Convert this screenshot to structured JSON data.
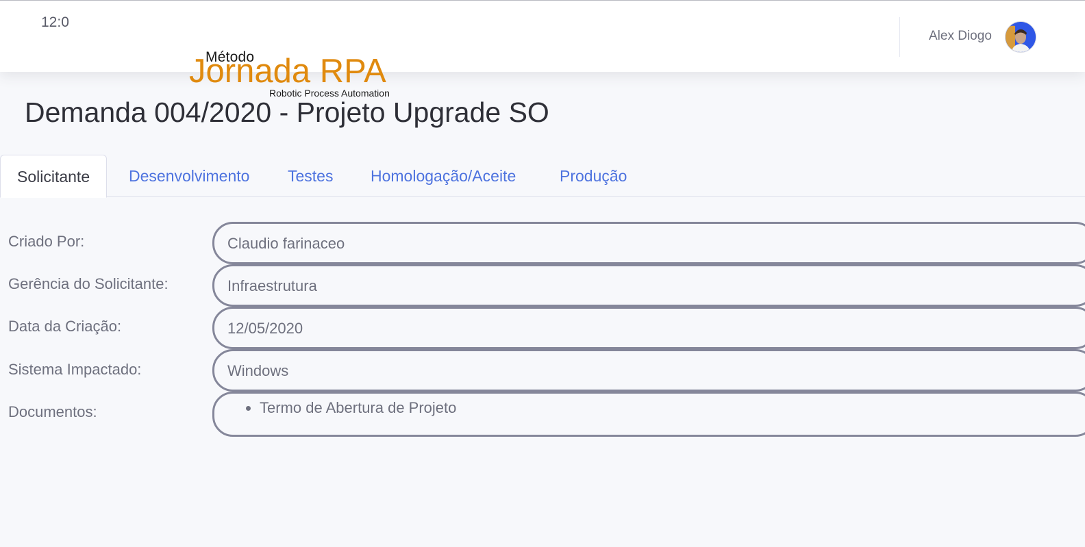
{
  "header": {
    "clock": "12:0",
    "user_name": "Alex Diogo"
  },
  "logo": {
    "line1": "Método",
    "line2": "Jornada RPA",
    "line3": "Robotic Process Automation"
  },
  "page_title": "Demanda 004/2020 - Projeto Upgrade SO",
  "tabs": [
    {
      "label": "Solicitante",
      "active": true
    },
    {
      "label": "Desenvolvimento",
      "active": false
    },
    {
      "label": "Testes",
      "active": false
    },
    {
      "label": "Homologação/Aceite",
      "active": false
    },
    {
      "label": "Produção",
      "active": false
    }
  ],
  "form": {
    "criado_por": {
      "label": "Criado Por:",
      "value": "Claudio farinaceo"
    },
    "gerencia": {
      "label": "Gerência do Solicitante:",
      "value": "Infraestrutura"
    },
    "data_criacao": {
      "label": "Data da Criação:",
      "value": "12/05/2020"
    },
    "sistema": {
      "label": "Sistema Impactado:",
      "value": "Windows"
    },
    "documentos": {
      "label": "Documentos:",
      "items": [
        "Termo de Abertura de Projeto"
      ]
    }
  },
  "colors": {
    "accent": "#4e73df",
    "logo_orange": "#e08a0e",
    "field_border": "#85879a",
    "background": "#f7f8fb"
  }
}
